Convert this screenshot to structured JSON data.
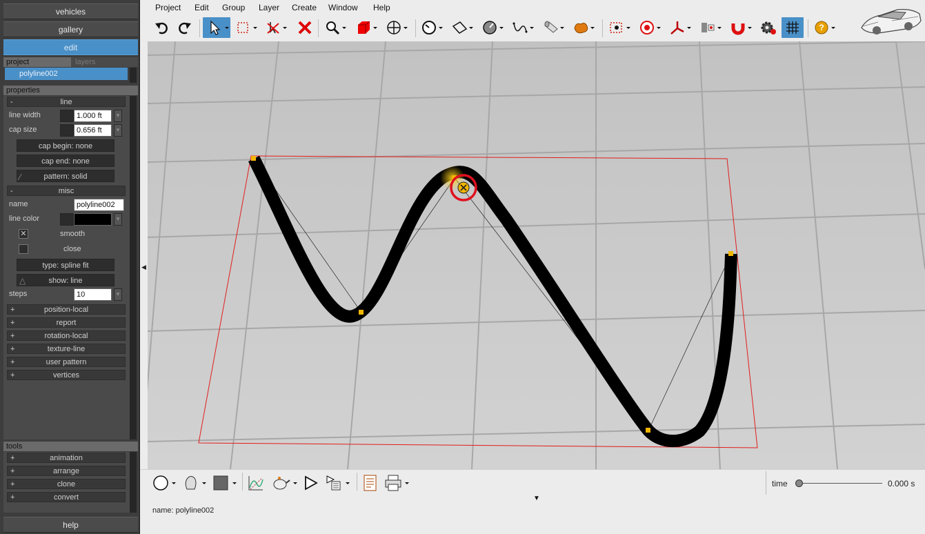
{
  "nav": {
    "vehicles": "vehicles",
    "gallery": "gallery",
    "edit": "edit"
  },
  "project": {
    "tab_project": "project",
    "tab_layers": "layers",
    "selected_item": "polyline002"
  },
  "properties": {
    "header": "properties",
    "line": {
      "group": "line",
      "line_width_label": "line width",
      "line_width_value": "1.000 ft",
      "cap_size_label": "cap size",
      "cap_size_value": "0.656 ft",
      "cap_begin": "cap begin: none",
      "cap_end": "cap end: none",
      "pattern": "pattern: solid"
    },
    "misc": {
      "group": "misc",
      "name_label": "name",
      "name_value": "polyline002",
      "line_color_label": "line color",
      "line_color": "#000000",
      "smooth_label": "smooth",
      "smooth_checked": true,
      "close_label": "close",
      "close_checked": false,
      "type": "type: spline fit",
      "show": "show: line",
      "steps_label": "steps",
      "steps_value": "10"
    },
    "collapsed_groups": [
      "position-local",
      "report",
      "rotation-local",
      "texture-line",
      "user pattern",
      "vertices"
    ]
  },
  "tools": {
    "header": "tools",
    "groups": [
      "animation",
      "arrange",
      "clone",
      "convert"
    ]
  },
  "help": "help",
  "menubar": [
    "Project",
    "Edit",
    "Group",
    "Layer",
    "Create",
    "Window",
    "Help"
  ],
  "toolbar_icons": [
    "undo-icon",
    "redo-icon",
    "select-arrow-icon",
    "select-rectangle-icon",
    "deselect-icon",
    "delete-icon",
    "zoom-icon",
    "cube-icon",
    "move-icon",
    "dial-icon",
    "plane-icon",
    "dial2-icon",
    "curve-icon",
    "cylinder-icon",
    "blob-icon",
    "snap-box-icon",
    "target-icon",
    "axis-icon",
    "align-icon",
    "magnet-icon",
    "gear-icon",
    "grid-icon",
    "help-icon"
  ],
  "status": {
    "name_text": "name: polyline002",
    "time_label": "time",
    "time_value": "0.000 s",
    "time_progress": 0
  },
  "colors": {
    "accent": "#4a90c8",
    "handle": "#f2b600",
    "bbox": "#e21b1b",
    "highlight": "#e0101e"
  }
}
